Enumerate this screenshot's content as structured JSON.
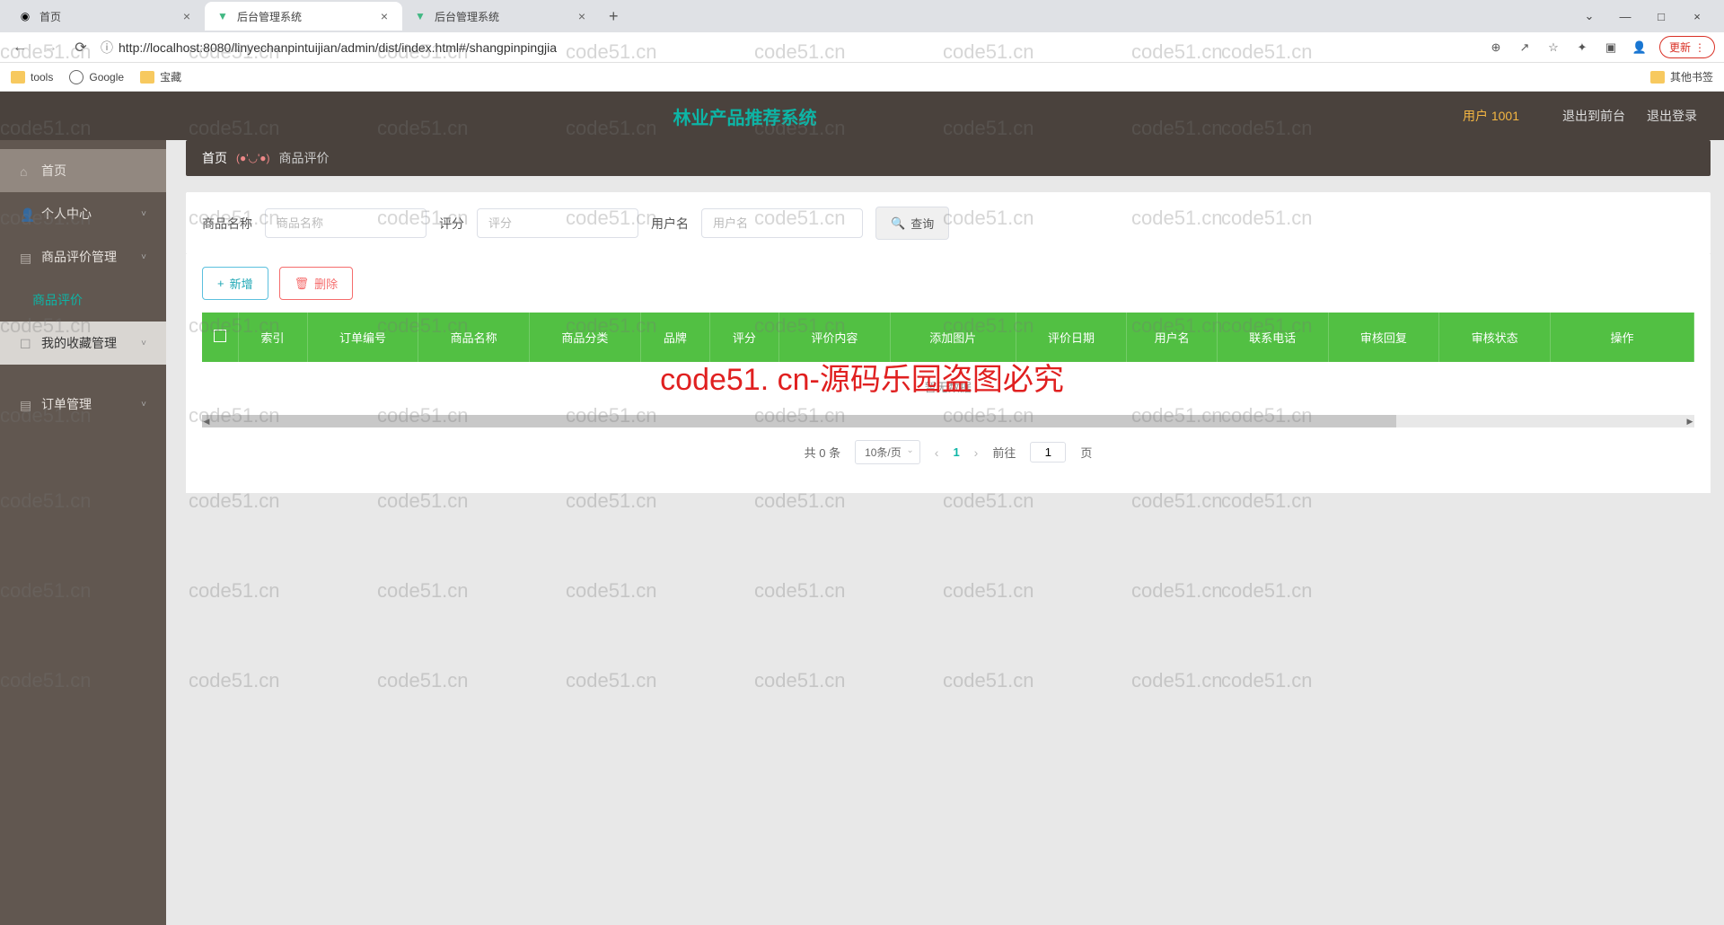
{
  "browser": {
    "tabs": [
      {
        "title": "首页",
        "favicon": "globe"
      },
      {
        "title": "后台管理系统",
        "favicon": "vue"
      },
      {
        "title": "后台管理系统",
        "favicon": "vue"
      }
    ],
    "url": "http://localhost:8080/linyechanpintuijian/admin/dist/index.html#/shangpinpingjia",
    "update_label": "更新",
    "bookmarks": [
      {
        "label": "tools",
        "type": "folder"
      },
      {
        "label": "Google",
        "type": "globe"
      },
      {
        "label": "宝藏",
        "type": "folder"
      }
    ],
    "other_bookmarks": "其他书签"
  },
  "header": {
    "title": "林业产品推荐系统",
    "user_label": "用户 1001",
    "exit_front": "退出到前台",
    "logout": "退出登录"
  },
  "sidebar": {
    "items": [
      {
        "label": "首页"
      },
      {
        "label": "个人中心"
      },
      {
        "label": "商品评价管理"
      },
      {
        "label": "商品评价"
      },
      {
        "label": "我的收藏管理"
      },
      {
        "label": "订单管理"
      }
    ]
  },
  "breadcrumb": {
    "home": "首页",
    "sep": "(●'◡'●)",
    "current": "商品评价"
  },
  "search": {
    "name_label": "商品名称",
    "name_placeholder": "商品名称",
    "rating_label": "评分",
    "rating_placeholder": "评分",
    "user_label": "用户名",
    "user_placeholder": "用户名",
    "search_btn": "查询"
  },
  "actions": {
    "add": "新增",
    "delete": "删除"
  },
  "table": {
    "headers": [
      "索引",
      "订单编号",
      "商品名称",
      "商品分类",
      "品牌",
      "评分",
      "评价内容",
      "添加图片",
      "评价日期",
      "用户名",
      "联系电话",
      "审核回复",
      "审核状态",
      "操作"
    ],
    "empty": "暂无数据"
  },
  "pagination": {
    "total": "共 0 条",
    "per_page": "10条/页",
    "current": "1",
    "goto_pre": "前往",
    "goto_val": "1",
    "goto_suf": "页"
  },
  "watermark": {
    "text": "code51.cn",
    "big": "code51. cn-源码乐园盗图必究"
  }
}
